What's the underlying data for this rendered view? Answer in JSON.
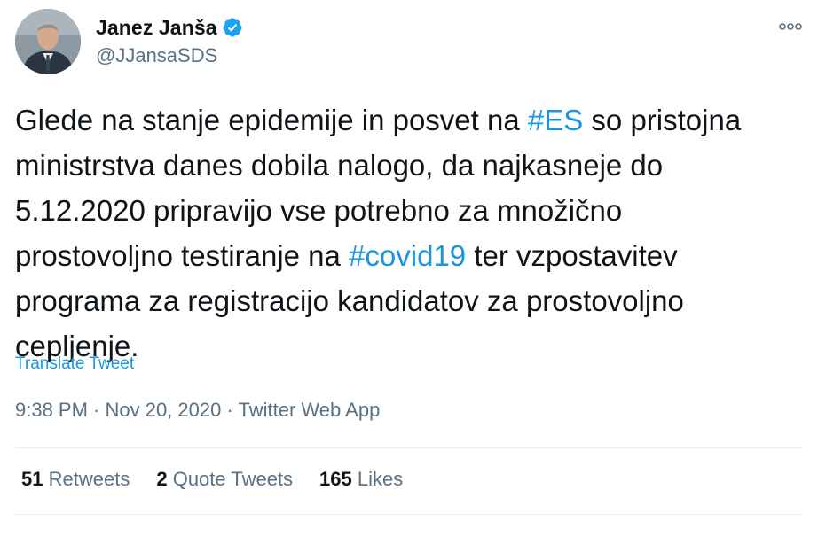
{
  "author": {
    "display_name": "Janez Janša",
    "handle": "@JJansaSDS",
    "verified": true
  },
  "tweet": {
    "segments": [
      {
        "text": "Glede na stanje epidemije in posvet na ",
        "type": "text"
      },
      {
        "text": "#ES",
        "type": "hashtag"
      },
      {
        "text": " so pristojna\nministrstva danes dobila nalogo, da najkasneje do\n5.12.2020 pripravijo vse potrebno za množično\nprostovoljno testiranje na ",
        "type": "text"
      },
      {
        "text": "#covid19",
        "type": "hashtag"
      },
      {
        "text": " ter vzpostavitev\nprograma za registracijo kandidatov za prostovoljno\ncepljenje.",
        "type": "text"
      }
    ],
    "translate_label": "Translate Tweet",
    "time": "9:38 PM",
    "date": "Nov 20, 2020",
    "source": "Twitter Web App",
    "separator": " · "
  },
  "stats": {
    "retweets": {
      "count": "51",
      "label": "Retweets"
    },
    "quotes": {
      "count": "2",
      "label": "Quote Tweets"
    },
    "likes": {
      "count": "165",
      "label": "Likes"
    }
  },
  "colors": {
    "accent": "#1b95e0",
    "verified": "#1da1f2",
    "muted": "#5b7083",
    "text": "#0f1419"
  },
  "icons": {
    "more": "more-options-icon",
    "verified": "verified-badge-icon"
  }
}
